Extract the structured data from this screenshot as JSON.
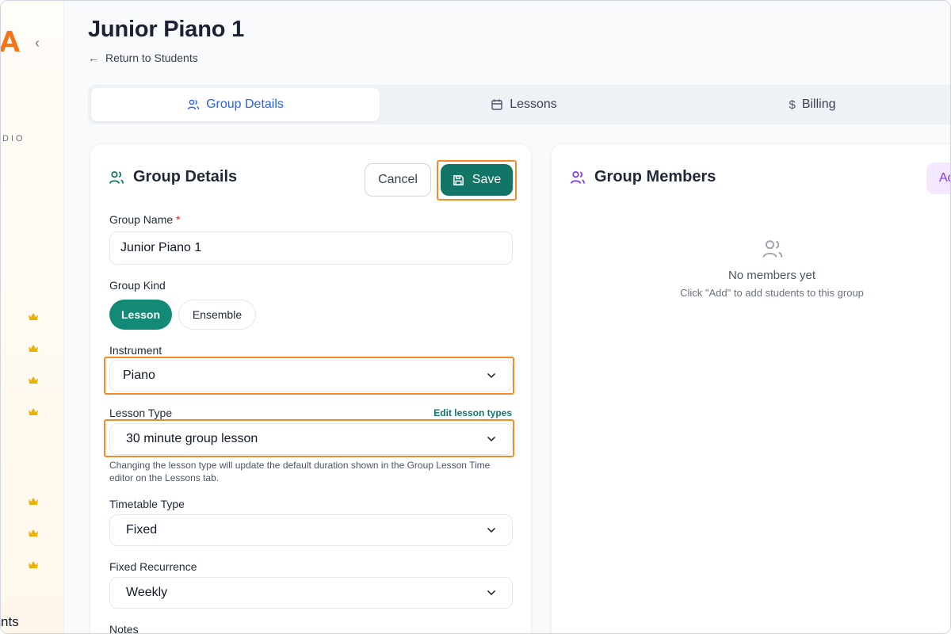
{
  "sidebar": {
    "studio_label": "DIO",
    "bottom_label": "nts"
  },
  "page": {
    "title": "Junior Piano 1",
    "back_label": "Return to Students"
  },
  "tabs": [
    {
      "label": "Group Details",
      "icon": "users-icon",
      "active": true
    },
    {
      "label": "Lessons",
      "icon": "calendar-icon",
      "active": false
    },
    {
      "label": "Billing",
      "icon": "dollar-icon",
      "active": false
    }
  ],
  "details": {
    "title": "Group Details",
    "cancel_label": "Cancel",
    "save_label": "Save",
    "group_name_label": "Group Name",
    "group_name_required": "*",
    "group_name_value": "Junior Piano 1",
    "group_kind_label": "Group Kind",
    "group_kind_options": [
      "Lesson",
      "Ensemble"
    ],
    "group_kind_selected": "Lesson",
    "instrument_label": "Instrument",
    "instrument_value": "Piano",
    "lesson_type_label": "Lesson Type",
    "edit_lesson_types_label": "Edit lesson types",
    "lesson_type_value": "30 minute group lesson",
    "lesson_type_help": "Changing the lesson type will update the default duration shown in the Group Lesson Time editor on the Lessons tab.",
    "timetable_type_label": "Timetable Type",
    "timetable_type_value": "Fixed",
    "fixed_recurrence_label": "Fixed Recurrence",
    "fixed_recurrence_value": "Weekly",
    "notes_label": "Notes"
  },
  "members": {
    "title": "Group Members",
    "add_label": "Add",
    "empty_title": "No members yet",
    "empty_subtitle": "Click \"Add\" to add students to this group"
  },
  "colors": {
    "accent_teal": "#127566",
    "highlight_orange": "#f28c28",
    "active_tab_blue": "#2563eb",
    "members_purple": "#7c3aed"
  }
}
